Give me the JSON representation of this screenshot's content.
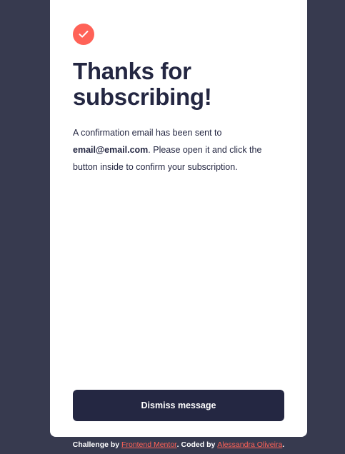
{
  "card": {
    "icon": "check-icon",
    "title": "Thanks for subscribing!",
    "message_prefix": "A confirmation email has been sent to ",
    "email": "email@email.com",
    "message_suffix": ". Please open it and click the button inside to confirm your subscription.",
    "dismiss_label": "Dismiss message"
  },
  "attribution": {
    "prefix": "Challenge by ",
    "link1": "Frontend Mentor",
    "middle": ". Coded by ",
    "link2": "Alessandra Oliveira",
    "suffix": "."
  },
  "colors": {
    "background": "#373a4f",
    "card": "#ffffff",
    "accent": "#ff6257",
    "text": "#242742",
    "button": "#242742"
  }
}
